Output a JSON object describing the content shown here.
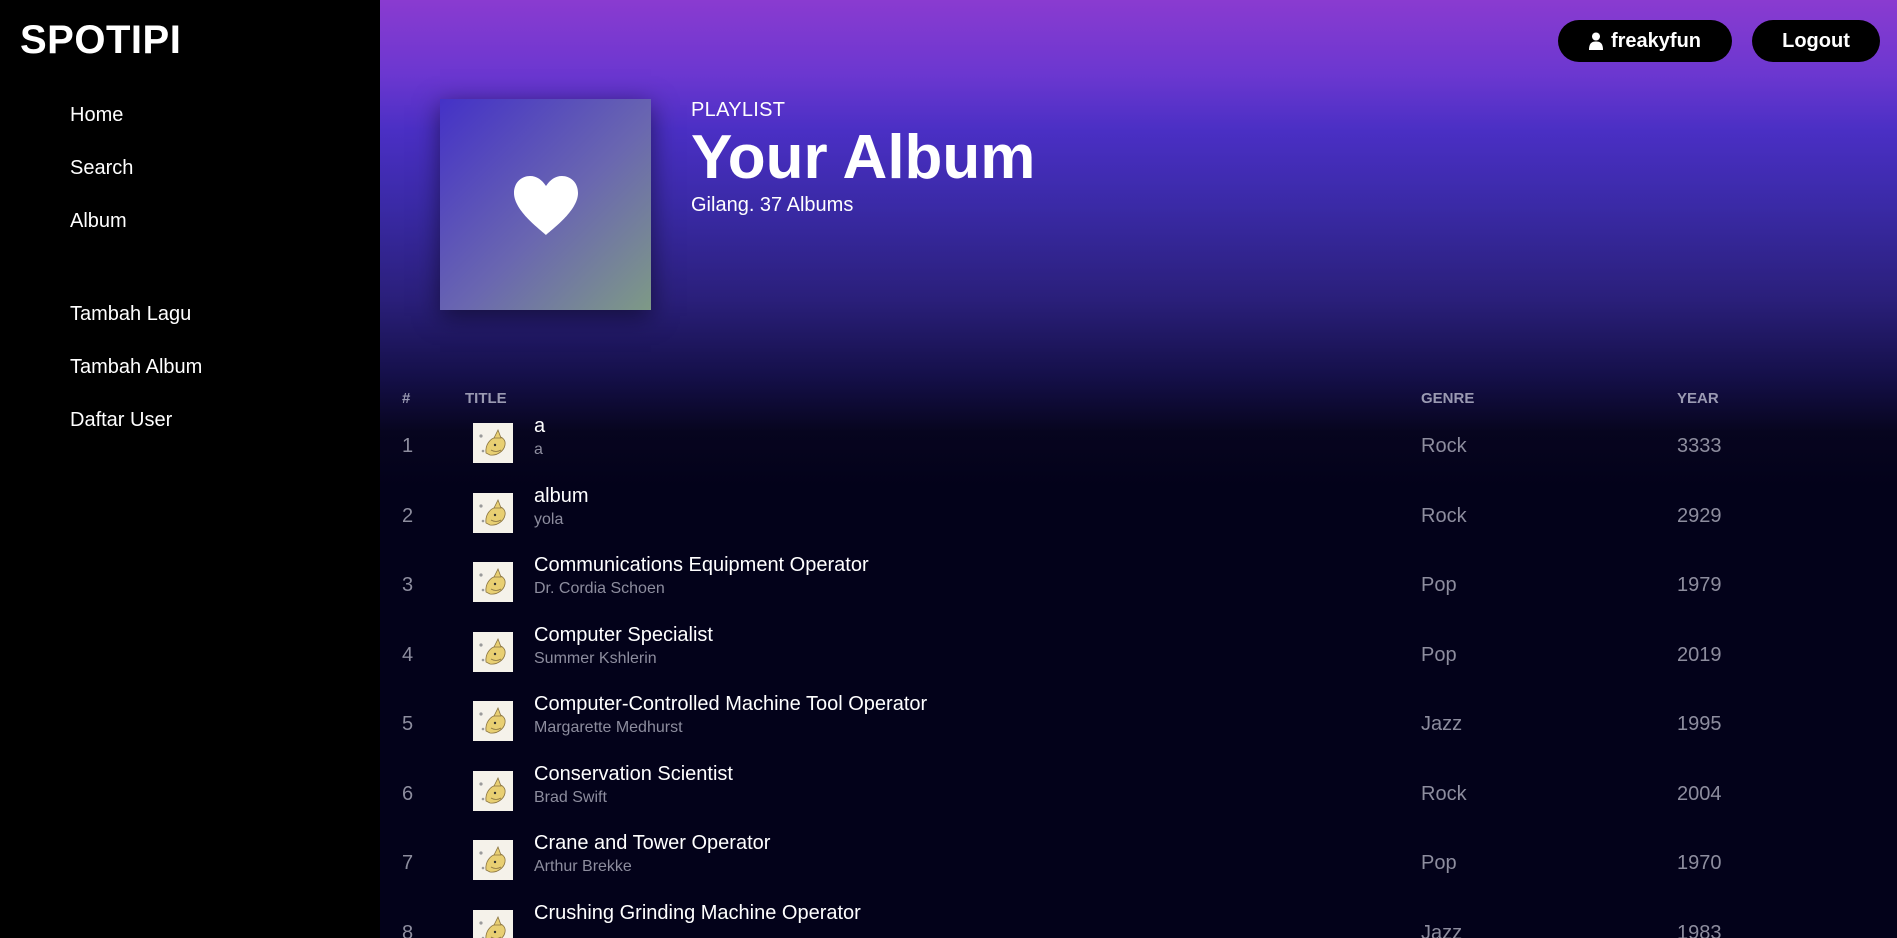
{
  "app": {
    "logo": "SPOTIPI"
  },
  "sidebar": {
    "primary": [
      {
        "label": "Home"
      },
      {
        "label": "Search"
      },
      {
        "label": "Album"
      }
    ],
    "secondary": [
      {
        "label": "Tambah Lagu"
      },
      {
        "label": "Tambah Album"
      },
      {
        "label": "Daftar User"
      }
    ]
  },
  "topbar": {
    "username": "freakyfun",
    "user_icon": "user-icon",
    "logout_label": "Logout"
  },
  "header": {
    "type": "PLAYLIST",
    "title": "Your Album",
    "subtitle": "Gilang. 37 Albums",
    "cover_icon": "heart-icon"
  },
  "table": {
    "columns": {
      "num": "#",
      "title": "TITLE",
      "genre": "GENRE",
      "year": "YEAR"
    },
    "rows": [
      {
        "num": "1",
        "title": "a",
        "artist": "a",
        "genre": "Rock",
        "year": "3333"
      },
      {
        "num": "2",
        "title": "album",
        "artist": "yola",
        "genre": "Rock",
        "year": "2929"
      },
      {
        "num": "3",
        "title": "Communications Equipment Operator",
        "artist": "Dr. Cordia Schoen",
        "genre": "Pop",
        "year": "1979"
      },
      {
        "num": "4",
        "title": "Computer Specialist",
        "artist": "Summer Kshlerin",
        "genre": "Pop",
        "year": "2019"
      },
      {
        "num": "5",
        "title": "Computer-Controlled Machine Tool Operator",
        "artist": "Margarette Medhurst",
        "genre": "Jazz",
        "year": "1995"
      },
      {
        "num": "6",
        "title": "Conservation Scientist",
        "artist": "Brad Swift",
        "genre": "Rock",
        "year": "2004"
      },
      {
        "num": "7",
        "title": "Crane and Tower Operator",
        "artist": "Arthur Brekke",
        "genre": "Pop",
        "year": "1970"
      },
      {
        "num": "8",
        "title": "Crushing Grinding Machine Operator",
        "artist": "",
        "genre": "Jazz",
        "year": "1983"
      }
    ]
  }
}
